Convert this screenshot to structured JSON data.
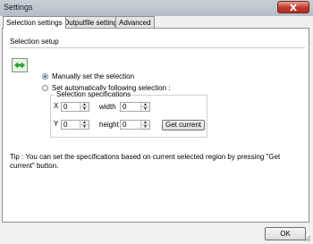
{
  "window": {
    "title": "Settings"
  },
  "tabs": [
    {
      "label": "Selection settings",
      "active": true
    },
    {
      "label": "Outputfile settings",
      "active": false
    },
    {
      "label": "Advanced",
      "active": false
    }
  ],
  "selection_setup": {
    "heading": "Selection setup",
    "radio_manual": {
      "label": "Manually set the selection",
      "checked": true
    },
    "radio_auto": {
      "label": "Set automatically following selection :",
      "checked": false
    },
    "specs": {
      "legend": "Selection specifications",
      "x": {
        "label": "X",
        "value": "0"
      },
      "y": {
        "label": "Y",
        "value": "0"
      },
      "width": {
        "label": "width",
        "value": "0"
      },
      "height": {
        "label": "height",
        "value": "0"
      },
      "get_current_label": "Get current"
    },
    "tip": "Tip : You can set the specifications based on current selected region by pressing \"Get current\" button."
  },
  "footer": {
    "ok_label": "OK"
  },
  "colors": {
    "radio_selected": "#2c6bd1",
    "close_button": "#c0392b",
    "icon_green": "#2e9e2e"
  }
}
